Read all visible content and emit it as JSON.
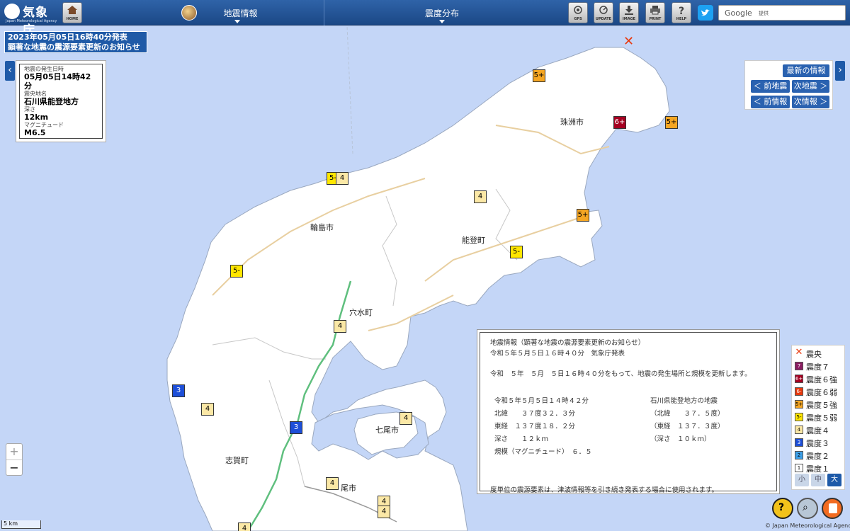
{
  "header": {
    "logo_name": "気象庁",
    "logo_en": "Japan Meteorological Agency",
    "home_label": "HOME",
    "menu1": "地震情報",
    "menu2": "震度分布",
    "buttons": [
      "GPS",
      "UPDATE",
      "IMAGE",
      "PRINT",
      "HELP"
    ],
    "search_brand": "Google",
    "search_hint": "提供"
  },
  "title_box": {
    "line1": "2023年05月05日16時40分発表",
    "line2": "顕著な地震の震源要素更新のお知らせ"
  },
  "info_card": {
    "occurrence_label": "地震の発生日時",
    "occurrence_value": "05月05日14時42分",
    "epicenter_label": "震央地名",
    "epicenter_value": "石川県能登地方",
    "depth_label": "深さ",
    "depth_value": "12km",
    "magnitude_label": "マグニチュード",
    "magnitude_value": "M6.5"
  },
  "nav": {
    "latest": "最新の情報",
    "prev_quake": "＜ 前地震",
    "next_quake": "次地震 ＞",
    "prev_info": "＜ 前情報",
    "next_info": "次情報 ＞"
  },
  "map": {
    "cities": [
      "珠洲市",
      "輪島市",
      "能登町",
      "穴水町",
      "七尾市",
      "志賀町",
      "尾市"
    ],
    "intensity_labels": [
      "5+",
      "6+",
      "5+",
      "5-",
      "4",
      "4",
      "5+",
      "5-",
      "5-",
      "4",
      "3",
      "4",
      "3",
      "4",
      "4",
      "4",
      "4",
      "4"
    ],
    "epicenter_mark": "✕"
  },
  "notice": {
    "l1": "地震情報（顕著な地震の震源要素更新のお知らせ）",
    "l2": "令和５年５月５日１６時４０分　気象庁発表",
    "l3": "令和　５年　５月　５日１６時４０分をもって、地震の発生場所と規模を更新します。",
    "l4a": "令和５年５月５日１４時４２分",
    "l4b": "石川県能登地方の地震",
    "l5a": "北緯　　３７度３２．３分",
    "l5b": "（北緯　　３７．５度）",
    "l6a": "東経　１３７度１８．２分",
    "l6b": "（東経　１３７．３度）",
    "l7a": "深さ　　１２ｋｍ",
    "l7b": "（深さ　１０ｋｍ）",
    "l8": "規模（マグニチュード）　６．５",
    "l9": "度単位の震源要素は、津波情報等を引き続き発表する場合に使用されます。"
  },
  "legend": {
    "items": [
      {
        "mark": "✕",
        "label": "震央",
        "color": "#e8380d"
      },
      {
        "mark": "7",
        "label": "震度７",
        "color": "#8b1c62"
      },
      {
        "mark": "6+",
        "label": "震度６強",
        "color": "#a50021"
      },
      {
        "mark": "6-",
        "label": "震度６弱",
        "color": "#e8380d"
      },
      {
        "mark": "5+",
        "label": "震度５強",
        "color": "#f5a623"
      },
      {
        "mark": "5-",
        "label": "震度５弱",
        "color": "#ffe600"
      },
      {
        "mark": "4",
        "label": "震度４",
        "color": "#fbe8a6"
      },
      {
        "mark": "3",
        "label": "震度３",
        "color": "#1d4fd8"
      },
      {
        "mark": "2",
        "label": "震度２",
        "color": "#3ea0e8"
      },
      {
        "mark": "1",
        "label": "震度１",
        "color": "#ffffff"
      }
    ],
    "size_small": "小",
    "size_mid": "中",
    "size_large": "大"
  },
  "zoom": {
    "plus": "+",
    "minus": "−"
  },
  "scale": "5 km",
  "copyright": "© Japan Meteorological Agency"
}
